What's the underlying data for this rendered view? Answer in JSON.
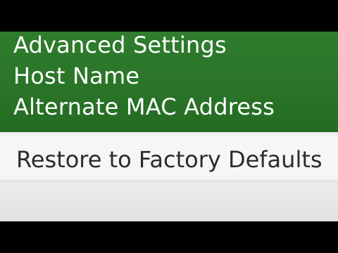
{
  "menu": {
    "items": [
      {
        "label": "Advanced Settings"
      },
      {
        "label": "Host Name"
      },
      {
        "label": "Alternate MAC Address"
      }
    ]
  },
  "restore": {
    "label": "Restore to Factory Defaults"
  },
  "colors": {
    "panel_green": "#2a7428",
    "menu_text": "#ffffff",
    "row_background": "#f6f6f6",
    "row_text": "#2b2b2b",
    "letterbox": "#000000"
  }
}
